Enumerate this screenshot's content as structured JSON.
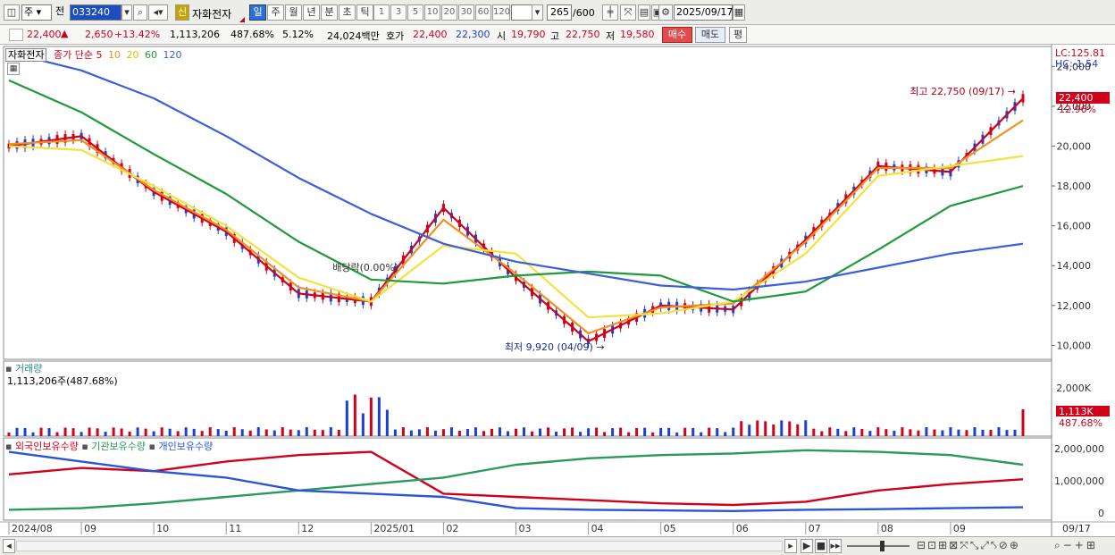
{
  "toolbar": {
    "market_type": "주",
    "prev_label": "전",
    "stock_code": "033240",
    "stock_name_badge": "신",
    "stock_name": "자화전자",
    "period_buttons": [
      "일",
      "주",
      "월",
      "년",
      "분",
      "초",
      "틱"
    ],
    "active_period": "일",
    "interval_buttons": [
      "1",
      "3",
      "5",
      "10",
      "20",
      "30",
      "60",
      "120"
    ],
    "range_value": "265",
    "range_total": "/600",
    "date_value": "2025/09/17"
  },
  "quote": {
    "price": "22,400",
    "change_arrow": "▲",
    "change": "2,650",
    "change_pct": "+13.42%",
    "volume": "1,113,206",
    "volume_ratio": "487.68%",
    "turnover": "5.12%",
    "trade_amount": "24,024백만",
    "ask_label": "호가",
    "ask": "22,400",
    "bid": "22,300",
    "open_label": "시",
    "open": "19,790",
    "high_label": "고",
    "high": "22,750",
    "low_label": "저",
    "low": "19,580",
    "buy_label": "매수",
    "sell_label": "매도",
    "eval_label": "평"
  },
  "price_panel": {
    "stock_tag": "자화전자",
    "ma_title": "종가 단순",
    "ma_periods": [
      "5",
      "10",
      "20",
      "60",
      "120"
    ],
    "ma_colors": [
      "#d0021b",
      "#f0901e",
      "#f2e23a",
      "#1f9a3a",
      "#3a5fd8"
    ],
    "lc_label": "LC:125.81",
    "hc_label": "HC:-1.54",
    "y_ticks": [
      "24,000",
      "22,000",
      "20,000",
      "18,000",
      "16,000",
      "14,000",
      "12,000",
      "10,000"
    ],
    "current_price_tag": "22,400",
    "current_pct_tag": "12.96%",
    "high_note": "최고 22,750 (09/17)",
    "low_note": "최저 9,920 (04/09)",
    "dividend_note": "배당락(0.00%)"
  },
  "volume_panel": {
    "title": "거래량",
    "value": "1,113,206주(487.68%)",
    "y_ticks": [
      "2,000K"
    ],
    "current_tag": "1,113K",
    "current_pct": "487.68%"
  },
  "holding_panel": {
    "legend": [
      {
        "label": "외국인보유수량",
        "color": "#d0021b"
      },
      {
        "label": "기관보유수량",
        "color": "#2a9a5a"
      },
      {
        "label": "개인보유수량",
        "color": "#2a55d8"
      }
    ],
    "y_ticks": [
      "2,000,000",
      "1,000,000",
      "0"
    ]
  },
  "x_axis": {
    "labels": [
      "2024/08",
      "09",
      "10",
      "11",
      "12",
      "2025/01",
      "02",
      "03",
      "04",
      "05",
      "06",
      "07",
      "08",
      "09",
      "09/17"
    ]
  },
  "chart_data": {
    "type": "line",
    "x": [
      "2024/08",
      "2024/09",
      "2024/10",
      "2024/11",
      "2024/12",
      "2025/01",
      "2025/02",
      "2025/03",
      "2025/04",
      "2025/05",
      "2025/06",
      "2025/07",
      "2025/08",
      "2025/09",
      "2025/09/17"
    ],
    "series": [
      {
        "name": "5",
        "values": [
          20000,
          20500,
          17700,
          15700,
          12600,
          12200,
          16900,
          13400,
          10200,
          12000,
          11800,
          15300,
          19000,
          18700,
          22400
        ]
      },
      {
        "name": "10",
        "values": [
          20100,
          20300,
          17800,
          15800,
          12900,
          12200,
          16300,
          13600,
          10600,
          11900,
          12100,
          15200,
          18900,
          18900,
          21300
        ]
      },
      {
        "name": "20",
        "values": [
          20000,
          19800,
          18000,
          16000,
          13400,
          12200,
          15000,
          14600,
          11400,
          11600,
          12200,
          14600,
          18500,
          19000,
          19500
        ]
      },
      {
        "name": "60",
        "values": [
          23300,
          21700,
          19600,
          17600,
          15200,
          13300,
          13100,
          13500,
          13700,
          13500,
          12200,
          12700,
          14800,
          17000,
          18000
        ]
      },
      {
        "name": "120",
        "values": [
          24700,
          23800,
          22400,
          20500,
          18400,
          16600,
          15100,
          14200,
          13600,
          13000,
          12800,
          13200,
          13900,
          14600,
          15100
        ]
      }
    ],
    "holdings": {
      "series": [
        {
          "name": "외국인보유수량",
          "values": [
            1200000,
            1400000,
            1300000,
            1600000,
            1800000,
            1900000,
            600000,
            500000,
            400000,
            300000,
            250000,
            350000,
            700000,
            900000,
            1050000
          ]
        },
        {
          "name": "기관보유수량",
          "values": [
            100000,
            150000,
            300000,
            500000,
            700000,
            900000,
            1100000,
            1500000,
            1700000,
            1800000,
            1850000,
            1950000,
            1900000,
            1800000,
            1500000
          ]
        },
        {
          "name": "개인보유수량",
          "values": [
            1900000,
            1600000,
            1300000,
            1100000,
            700000,
            600000,
            500000,
            150000,
            100000,
            80000,
            60000,
            100000,
            120000,
            150000,
            180000
          ]
        }
      ]
    },
    "ylim": [
      9300,
      25000
    ]
  }
}
